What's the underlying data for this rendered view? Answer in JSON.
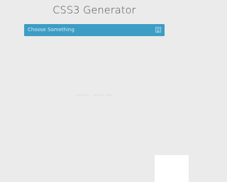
{
  "header": {
    "title": "CSS3 Generator"
  },
  "selector": {
    "placeholder": "Choose Something",
    "toggle_icon": "list-icon"
  },
  "footer": {
    "credit": "Designed by ... · Generator · CSS3 ·"
  },
  "colors": {
    "background": "#ebebeb",
    "accent": "#3d9dc4",
    "title_text": "#4a4a4a",
    "panel": "#ffffff"
  }
}
